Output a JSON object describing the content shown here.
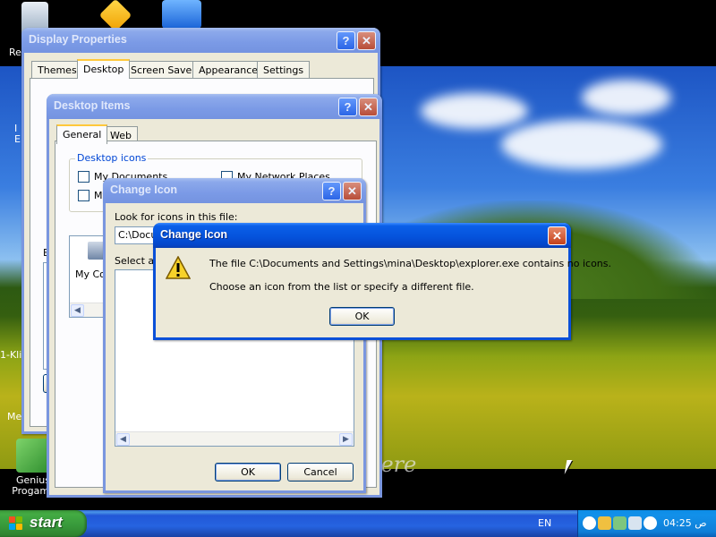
{
  "desktop": {
    "icons": [
      {
        "name": "recycle-bin",
        "label": "Re"
      },
      {
        "name": "partial-icon-1",
        "label": "I\nE"
      },
      {
        "name": "partial-icon-2",
        "label": "1-Kli"
      },
      {
        "name": "partial-icon-3",
        "label": "Me"
      },
      {
        "name": "genius-programs",
        "label": "Genius\nProgams"
      }
    ],
    "wallpaper_signature": "here"
  },
  "display_properties": {
    "title": "Display Properties",
    "tabs": [
      "Themes",
      "Desktop",
      "Screen Saver",
      "Appearance",
      "Settings"
    ],
    "active_tab": "Desktop",
    "partial_label": "B"
  },
  "desktop_items": {
    "title": "Desktop Items",
    "tabs": [
      "General",
      "Web"
    ],
    "group_title": "Desktop icons",
    "checkboxes": [
      "My Documents",
      "My",
      "My Network Places"
    ],
    "icon_list": [
      "My Co"
    ]
  },
  "change_icon_dialog": {
    "title": "Change Icon",
    "look_for_label": "Look for icons in this file:",
    "file_value": "C:\\Docu",
    "select_label": "Select an",
    "ok_label": "OK",
    "cancel_label": "Cancel"
  },
  "error_dialog": {
    "title": "Change Icon",
    "message_line1": "The file C:\\Documents and Settings\\mina\\Desktop\\explorer.exe contains no icons.",
    "message_line2": "Choose an icon from the list or specify a different file.",
    "ok_label": "OK",
    "icon": "warning-icon"
  },
  "taskbar": {
    "start_label": "start",
    "language": "EN",
    "clock": "04:25 ص"
  },
  "colors": {
    "title_active": "#0553dc",
    "title_inactive": "#7b9ae6",
    "window_face": "#ece9d8",
    "start_green": "#37983a"
  }
}
